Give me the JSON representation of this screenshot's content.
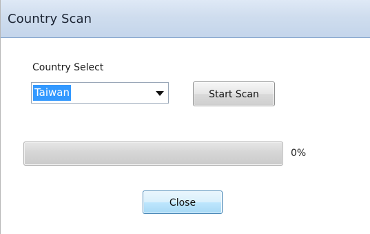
{
  "window": {
    "title": "Country Scan"
  },
  "country_select": {
    "label": "Country Select",
    "selected_value": "Taiwan"
  },
  "buttons": {
    "start_scan": "Start Scan",
    "close": "Close"
  },
  "progress": {
    "value_percent": 0,
    "label": "0%",
    "fill_color": "#06b025"
  },
  "icons": {
    "combo_arrow": "chevron-down-icon"
  },
  "colors": {
    "selection_highlight": "#3399ff",
    "close_button_border": "#3c7fb1"
  }
}
